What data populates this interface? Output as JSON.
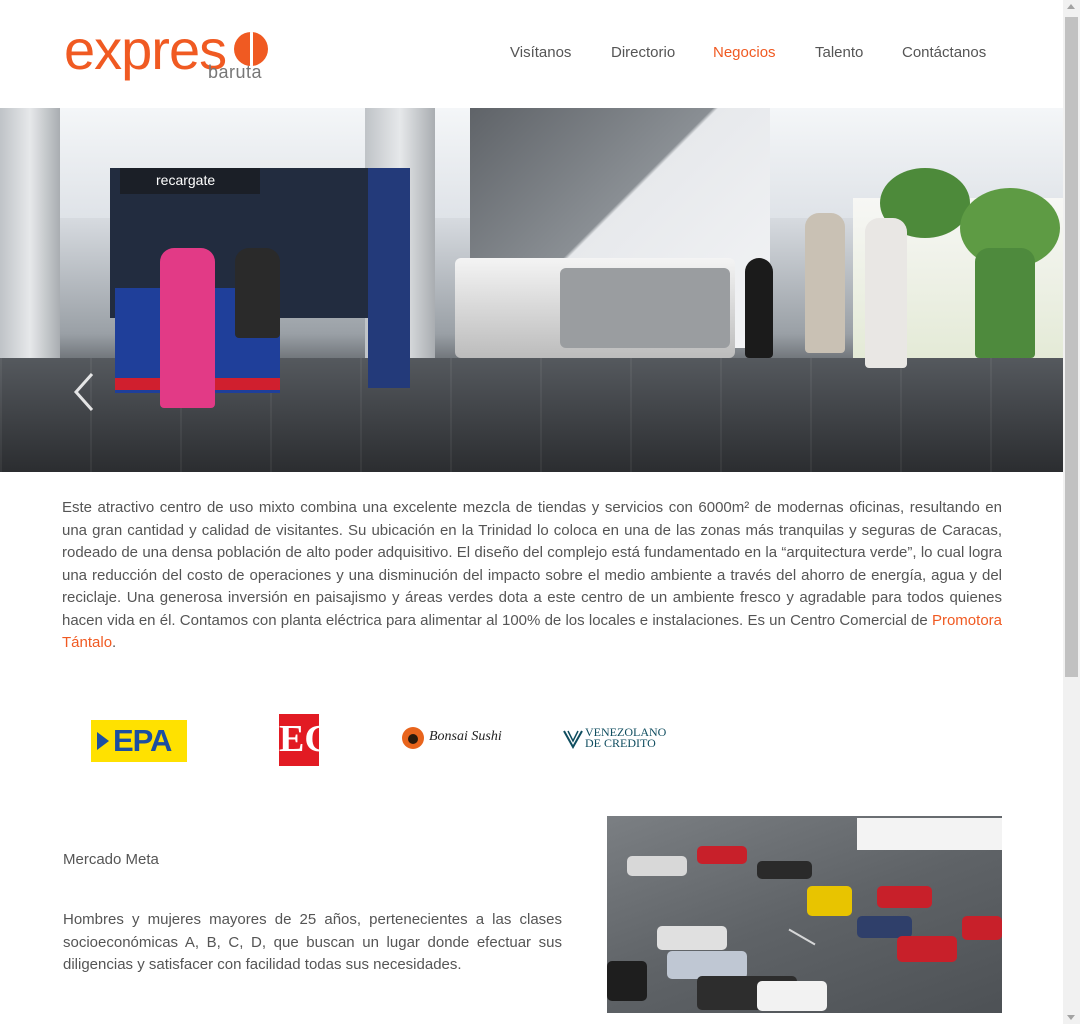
{
  "header": {
    "logo": {
      "word": "expreso",
      "sub": "baruta"
    },
    "nav": [
      {
        "label": "Visítanos",
        "active": false
      },
      {
        "label": "Directorio",
        "active": false
      },
      {
        "label": "Negocios",
        "active": true
      },
      {
        "label": "Talento",
        "active": false
      },
      {
        "label": "Contáctanos",
        "active": false
      }
    ]
  },
  "hero": {
    "kiosk_sign": "recargate",
    "prev_icon": "chevron-left-icon"
  },
  "intro": {
    "text": "Este atractivo centro de uso mixto combina una excelente mezcla de tiendas y servicios con 6000m² de modernas oficinas, resultando en una gran cantidad y calidad de visitantes. Su ubicación en la Trinidad lo coloca en una de las zonas más tranquilas y seguras de Caracas, rodeado de una densa población de alto poder adquisitivo. El diseño del complejo está fundamentado en la “arquitectura verde”, lo cual logra una reducción del costo de operaciones y una disminución del impacto sobre el medio ambiente a través del ahorro de energía, agua y del reciclaje. Una generosa inversión en paisajismo y áreas verdes dota a este centro de un ambiente fresco y agradable para todos quienes hacen vida en él. Contamos con planta eléctrica para alimentar al 100% de los locales e instalaciones. Es un Centro Comercial de ",
    "link": "Promotora Tántalo",
    "end": "."
  },
  "brands": {
    "epa": "EPA",
    "eg": "EG",
    "bonsai": "Bonsai Sushi",
    "vzla_line1": "VENEZOLANO",
    "vzla_line2": "DE CREDITO"
  },
  "mercado": {
    "title": "Mercado Meta",
    "description": "Hombres y mujeres mayores de 25 años, pertenecientes a las clases socioeconómicas A, B, C, D, que buscan un lugar donde efectuar sus diligencias y satisfacer con facilidad todas sus necesidades."
  },
  "colors": {
    "accent": "#f05a22",
    "text": "#555555",
    "epa_yellow": "#ffe100",
    "epa_blue": "#1c4fa1",
    "eg_red": "#e21b23"
  }
}
